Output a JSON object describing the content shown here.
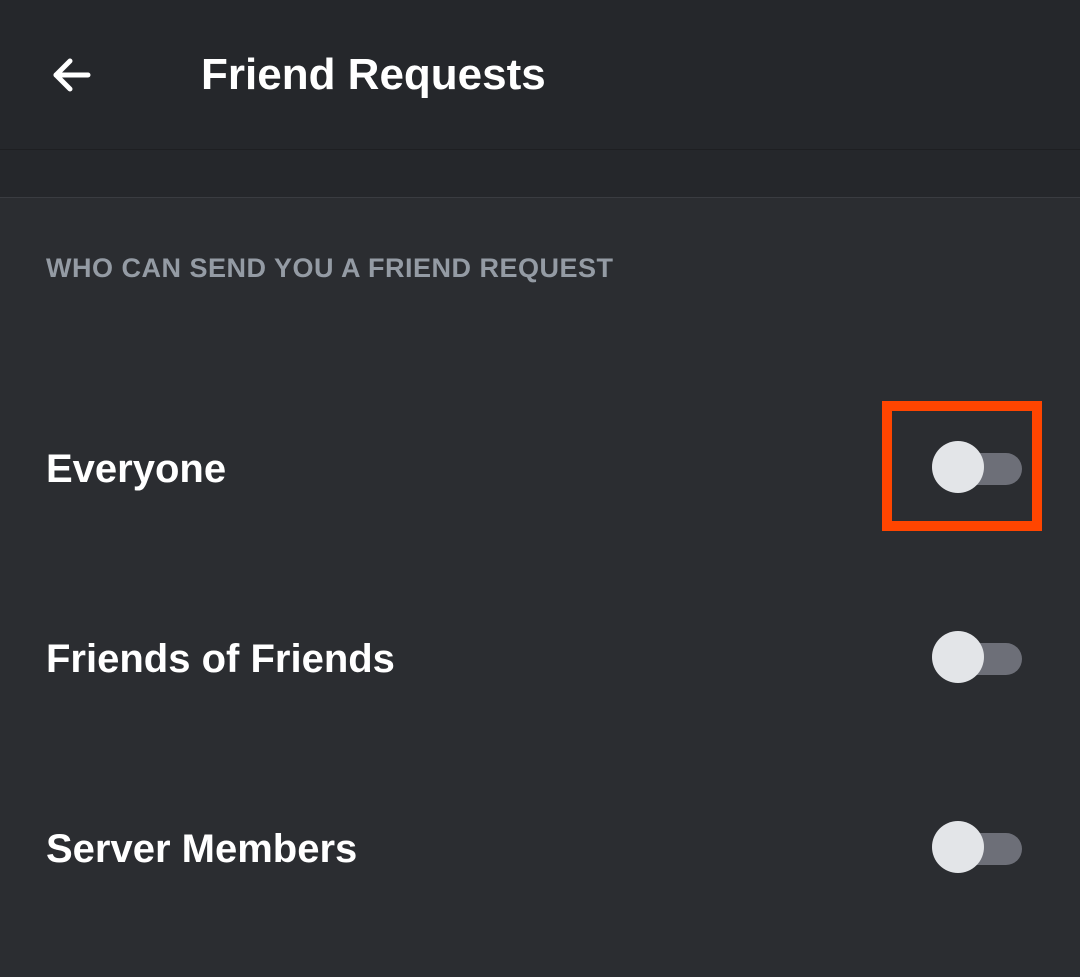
{
  "header": {
    "title": "Friend Requests"
  },
  "section": {
    "header": "WHO CAN SEND YOU A FRIEND REQUEST"
  },
  "settings": [
    {
      "label": "Everyone",
      "enabled": false,
      "highlighted": true
    },
    {
      "label": "Friends of Friends",
      "enabled": false,
      "highlighted": false
    },
    {
      "label": "Server Members",
      "enabled": false,
      "highlighted": false
    }
  ]
}
